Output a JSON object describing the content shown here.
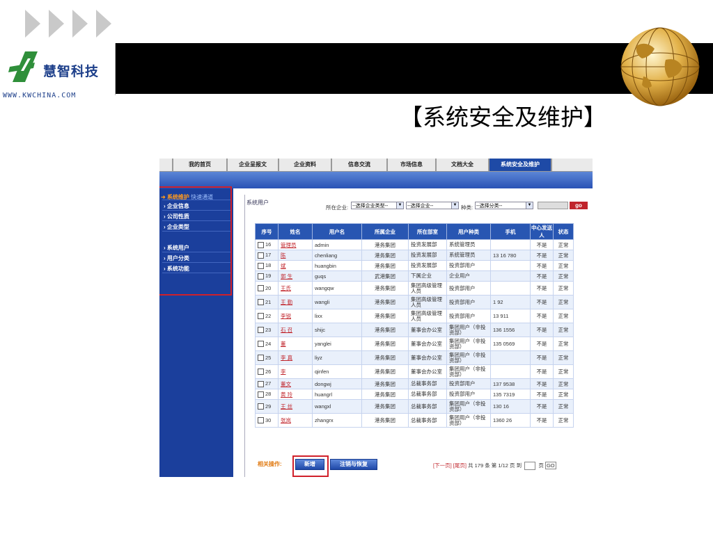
{
  "company": {
    "name": "慧智科技",
    "url": "WWW.KWCHINA.COM"
  },
  "slide_title": "【系统安全及维护】",
  "tabs": [
    "我的首页",
    "企业呈报文",
    "企业资料",
    "信息交流",
    "市场信息",
    "文档大全",
    "系统安全及维护"
  ],
  "active_tab": 6,
  "sidebar": {
    "header": "系统维护",
    "header_sub": "快速通道",
    "items": [
      "企业信息",
      "公司性质",
      "企业类型",
      "系统用户",
      "用户分类",
      "系统功能"
    ]
  },
  "breadcrumb": "系统用户",
  "filters": {
    "enterprise_label": "所在企业:",
    "enterprise_type_value": "--选择企业类型--",
    "enterprise_value": "--选择企业--",
    "category_label": "种类:",
    "category_value": "--选择分类--",
    "go_label": "go"
  },
  "table": {
    "headers": [
      "序号",
      "姓名",
      "用户名",
      "所属企业",
      "所在部室",
      "用户种类",
      "手机",
      "中心发送人",
      "状态"
    ],
    "rows": [
      [
        "16",
        "管理员",
        "admin",
        "港务集团",
        "投资发展部",
        "系统管理员",
        "",
        "不是",
        "正常"
      ],
      [
        "17",
        "陈",
        "chenliang",
        "港务集团",
        "投资发展部",
        "系统管理员",
        "13 16 780",
        "不是",
        "正常"
      ],
      [
        "18",
        "斌",
        "huangbin",
        "港务集团",
        "投资发展部",
        "投资部用户",
        "",
        "不是",
        "正常"
      ],
      [
        "19",
        "郭 生",
        "guqs",
        "武港集团",
        "下属企业",
        "企业用户",
        "",
        "不是",
        "正常"
      ],
      [
        "20",
        "王氏",
        "wangqw",
        "港务集团",
        "集团高级管理人员",
        "投资部用户",
        "",
        "不是",
        "正常"
      ],
      [
        "21",
        "王 勤",
        "wangli",
        "港务集团",
        "集团高级管理人员",
        "投资部用户",
        "1 92",
        "不是",
        "正常"
      ],
      [
        "22",
        "李锐",
        "lixx",
        "港务集团",
        "集团高级管理人员",
        "投资部用户",
        "13 911",
        "不是",
        "正常"
      ],
      [
        "23",
        "石 召",
        "shijc",
        "港务集团",
        "董事会办公室",
        "集团用户（非投资部）",
        "136 1556",
        "不是",
        "正常"
      ],
      [
        "24",
        "董",
        "yanglei",
        "港务集团",
        "董事会办公室",
        "集团用户（非投资部）",
        "135 0569",
        "不是",
        "正常"
      ],
      [
        "25",
        "李 真",
        "liyz",
        "港务集团",
        "董事会办公室",
        "集团用户（非投资部）",
        "",
        "不是",
        "正常"
      ],
      [
        "26",
        "李",
        "qinfen",
        "港务集团",
        "董事会办公室",
        "集团用户（非投资部）",
        "",
        "不是",
        "正常"
      ],
      [
        "27",
        "董文",
        "dongwj",
        "港务集团",
        "总裁事务部",
        "投资部用户",
        "137 9538",
        "不是",
        "正常"
      ],
      [
        "28",
        "黄 玲",
        "huangrl",
        "港务集团",
        "总裁事务部",
        "投资部用户",
        "135 7319",
        "不是",
        "正常"
      ],
      [
        "29",
        "王 丝",
        "wangxl",
        "港务集团",
        "总裁事务部",
        "集团用户（非投资部）",
        "130 16",
        "不是",
        "正常"
      ],
      [
        "30",
        "张岚",
        "zhangrx",
        "港务集团",
        "总裁事务部",
        "集团用户（非投资部）",
        "1360 26",
        "不是",
        "正常"
      ]
    ]
  },
  "actions": {
    "label": "相关操作:",
    "add_label": "新增",
    "cancel_restore_label": "注销与恢复"
  },
  "pager": {
    "prev": "[下一页]",
    "last": "[尾页]",
    "total_text": "共 179 条 第 1/12 页 到",
    "page_unit": "页",
    "go": "GO"
  }
}
